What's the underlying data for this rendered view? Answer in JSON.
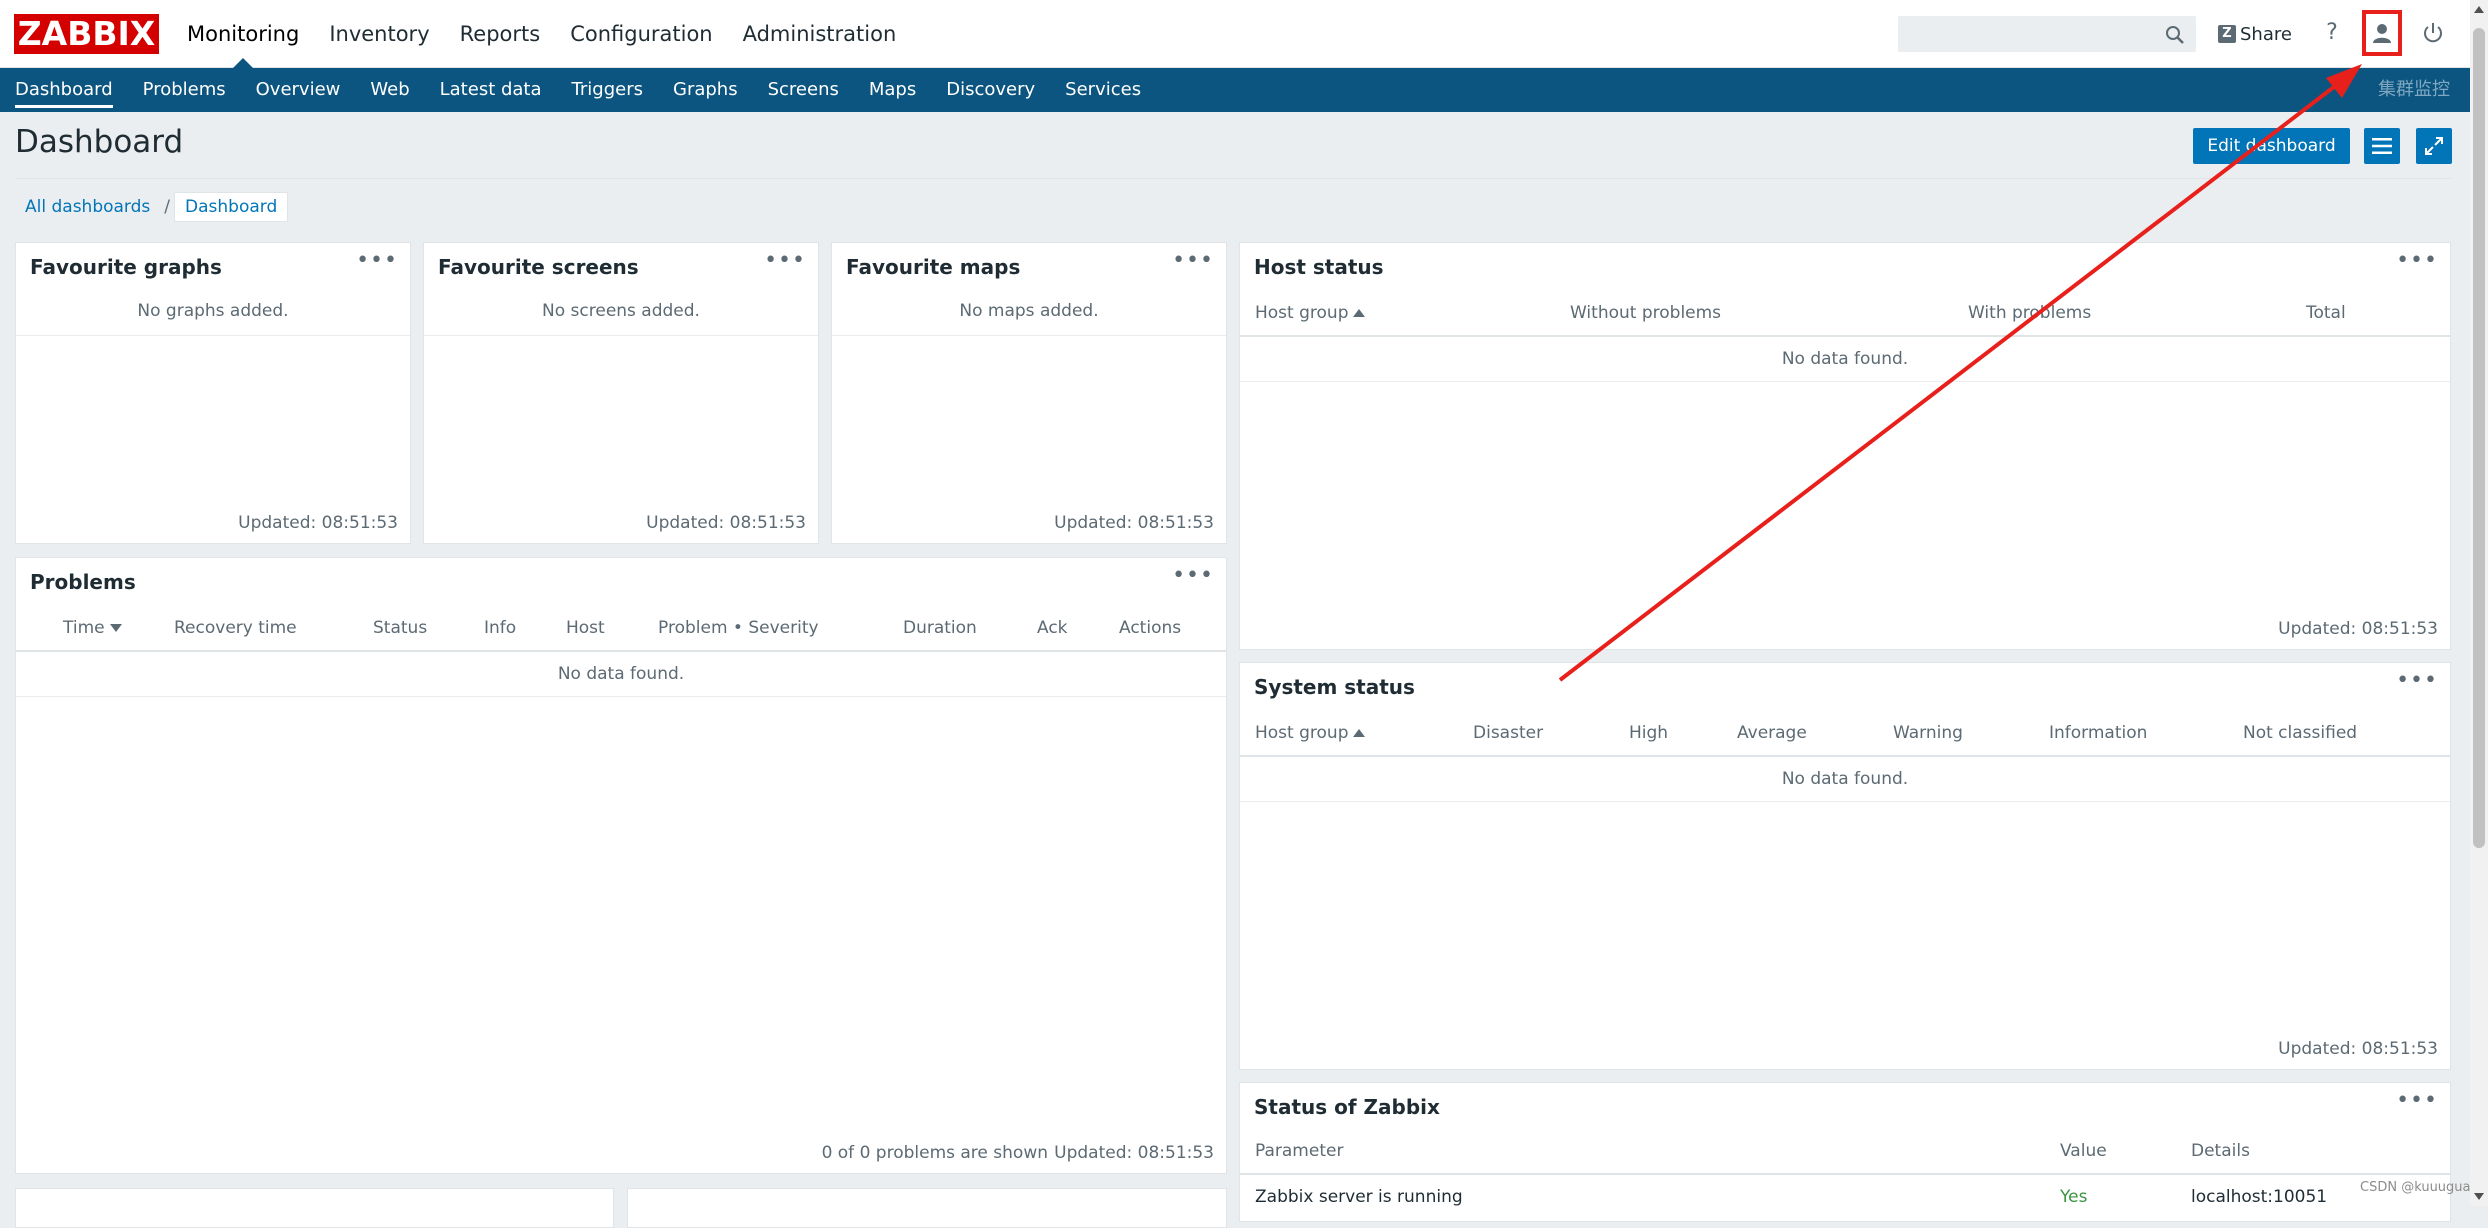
{
  "topbar": {
    "logo_text": "ZABBIX",
    "main_nav": [
      "Monitoring",
      "Inventory",
      "Reports",
      "Configuration",
      "Administration"
    ],
    "active_main": "Monitoring",
    "search_placeholder": "",
    "share_label": "Share",
    "share_badge": "Z",
    "help_symbol": "?"
  },
  "subnav": {
    "items": [
      "Dashboard",
      "Problems",
      "Overview",
      "Web",
      "Latest data",
      "Triggers",
      "Graphs",
      "Screens",
      "Maps",
      "Discovery",
      "Services"
    ],
    "active": "Dashboard",
    "cluster_label": "集群监控"
  },
  "page": {
    "title": "Dashboard",
    "edit_button": "Edit dashboard"
  },
  "breadcrumb": {
    "items": [
      "All dashboards",
      "Dashboard"
    ],
    "separator": "/"
  },
  "widgets": {
    "fav_graphs": {
      "title": "Favourite graphs",
      "empty": "No graphs added.",
      "updated": "Updated: 08:51:53"
    },
    "fav_screens": {
      "title": "Favourite screens",
      "empty": "No screens added.",
      "updated": "Updated: 08:51:53"
    },
    "fav_maps": {
      "title": "Favourite maps",
      "empty": "No maps added.",
      "updated": "Updated: 08:51:53"
    },
    "host_status": {
      "title": "Host status",
      "columns": [
        "Host group",
        "Without problems",
        "With problems",
        "Total"
      ],
      "empty": "No data found.",
      "updated": "Updated: 08:51:53"
    },
    "problems": {
      "title": "Problems",
      "columns": [
        "Time",
        "Recovery time",
        "Status",
        "Info",
        "Host",
        "Problem • Severity",
        "Duration",
        "Ack",
        "Actions"
      ],
      "empty": "No data found.",
      "shown": "0 of 0 problems are shown",
      "updated": "Updated: 08:51:53"
    },
    "system_status": {
      "title": "System status",
      "columns": [
        "Host group",
        "Disaster",
        "High",
        "Average",
        "Warning",
        "Information",
        "Not classified"
      ],
      "empty": "No data found.",
      "updated": "Updated: 08:51:53"
    },
    "zabbix_status": {
      "title": "Status of Zabbix",
      "columns": [
        "Parameter",
        "Value",
        "Details"
      ],
      "row1": {
        "parameter": "Zabbix server is running",
        "value": "Yes",
        "details": "localhost:10051"
      }
    },
    "dots": "•••"
  },
  "watermark": "CSDN @kuuugua",
  "colors": {
    "brand_red": "#d40000",
    "subnav_blue": "#0b5580",
    "button_blue": "#0275b8",
    "annotation_red": "#e8201c",
    "ok_green": "#3b9441"
  },
  "icons": {
    "search": "search-icon",
    "user": "user-icon",
    "power": "power-icon",
    "menu": "hamburger-menu-icon",
    "fullscreen": "fullscreen-icon"
  }
}
